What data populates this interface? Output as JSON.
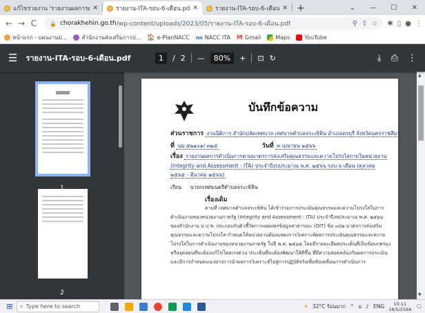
{
  "browser": {
    "tabs": [
      {
        "label": "แก้ไขรายงาน 'รายงานผลการดำเนินการ",
        "active": false
      },
      {
        "label": "รายงาน-ITA-รอบ-6-เดือน.pdf",
        "active": true
      },
      {
        "label": "รายงาน-ITA-รอบ-6-เดือน.pdf",
        "active": false
      }
    ],
    "new_tab": "+",
    "window_controls": {
      "chevron": "⌄",
      "minimize": "—",
      "maximize": "☐",
      "close": "✕"
    },
    "nav": {
      "back": "←",
      "forward": "→",
      "reload": "C"
    },
    "url_host": "chorakhehin.go.th",
    "url_path": "/wp-content/uploads/2023/05/รายงาน-ITA-รอบ-6-เดือน.pdf",
    "bookmarks": [
      {
        "label": "หน้าแรก - แผนงานป...",
        "color": "#e8a33d"
      },
      {
        "label": "สำนักงานส่งเสริมการป...",
        "color": "#9c5ab8"
      },
      {
        "label": "e-PlanNACC",
        "color": "#333333"
      },
      {
        "label": "NACC ITA",
        "color": "#1a73e8"
      },
      {
        "label": "Gmail",
        "color": "#ea4335"
      },
      {
        "label": "Maps",
        "color": "#34a853"
      },
      {
        "label": "YouTube",
        "color": "#ff0000"
      }
    ]
  },
  "pdf": {
    "title": "รายงาน-ITA-รอบ-6-เดือน.pdf",
    "page_current": "1",
    "page_total": "2",
    "page_sep": "/",
    "zoom": "80%",
    "zoom_minus": "—",
    "zoom_plus": "+",
    "thumbnails": [
      {
        "number": "1"
      },
      {
        "number": "2"
      }
    ]
  },
  "document": {
    "heading": "บันทึกข้อความ",
    "agency_label": "ส่วนราชการ",
    "agency_value": "งานนิติการ สำนักปลัดเทศบาล เทศบาลตำบลจระเข้หิน อำเภอครบุรี จังหวัดนครราชสีมา",
    "ref_label": "ที่",
    "ref_value": "นม ๕๒๑๐๑/ ๓๒๕",
    "date_label": "วันที่",
    "date_value": "๓ เมษายน ๒๕๖๖",
    "subject_label": "เรื่อง",
    "subject_value": "รายงานผลการดำเนินการตามมาตรการส่งเสริมคุณธรรมและความโปร่งใสภายในหน่วยงาน (Integrity and Assessment : ITA) ประจำปีงบประมาณ พ.ศ. ๒๕๖๖ รอบ ๖ เดือน (ตุลาคม ๒๕๖๕ - มีนาคม ๒๕๖๖)",
    "to_label": "เรียน",
    "to_value": "นายกเทศมนตรีตำบลจระเข้หิน",
    "origin_label": "เรื่องเดิม",
    "body": "ตามที่ เทศบาลตำบลจระเข้หิน ได้เข้าร่วมการประเมินคุณธรรมและความโปร่งใสในการดำเนินงานของหน่วยงานภาครัฐ (Integrity and Assessment : ITA) ประจำปีงบประมาณ พ.ศ. ๒๕๖๖ ของสำนักงาน ป.ป.ช. ประกอบกับตัวชี้วัดการเผยแพร่ข้อมูลสาธารณะ (OIT) ข้อ ๐๔๒ มาตรการส่งเสริมคุณธรรมและความโปร่งใส กำหนดให้หน่วยงานต้องแสดงการวิเคราะห์ผลการประเมินคุณธรรมและความโปร่งใสในการดำเนินงานของหน่วยงานภาครัฐ ในปี พ.ศ. ๒๕๖๕ โดยมีรายละเอียดประเด็นที่เป็นข้อบกพร่องหรือจุดอ่อนที่จะต้องแก้ไขโดยเร่งด่วน ประเด็นที่จะต้องพัฒนาให้ดีขึ้น ที่มีความสอดคล้องกับผลการประเมิน และมีการกำหนดแนวทางการนำผลการวิเคราะห์ไปสู่การปฏิบัติจริงเพื่อขับเคลื่อนการดำเนินการ"
  },
  "taskbar": {
    "search_placeholder": "Type here to search",
    "weather": "32°C ร้อนมาก",
    "lang": "ENG",
    "time": "10:11",
    "date": "18/5/2566"
  },
  "colors": {
    "pdf_toolbar": "#323639",
    "pdf_bg": "#525659",
    "thumb_highlight": "#8ab4f8"
  }
}
